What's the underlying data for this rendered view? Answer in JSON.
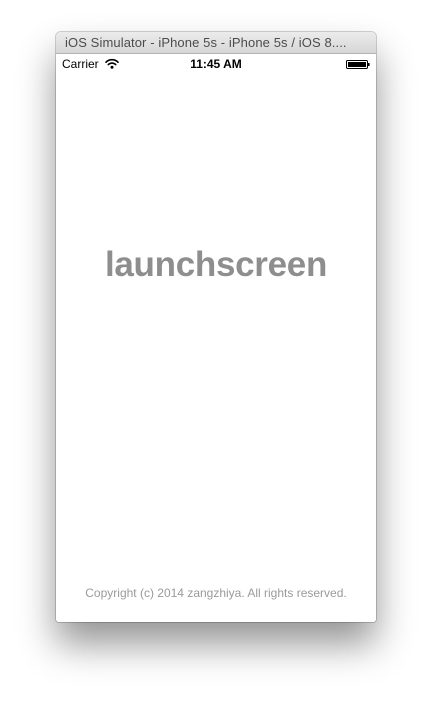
{
  "window": {
    "title": "iOS Simulator - iPhone 5s - iPhone 5s / iOS 8...."
  },
  "status_bar": {
    "carrier": "Carrier",
    "time": "11:45 AM",
    "signal_icon": "wifi-icon",
    "battery_icon": "battery-icon"
  },
  "launch_screen": {
    "title": "launchscreen",
    "copyright": "Copyright (c) 2014 zangzhiya. All rights reserved."
  },
  "colors": {
    "title_text": "#8e8e8e",
    "copyright_text": "#9a9a9a",
    "screen_background": "#ffffff"
  }
}
